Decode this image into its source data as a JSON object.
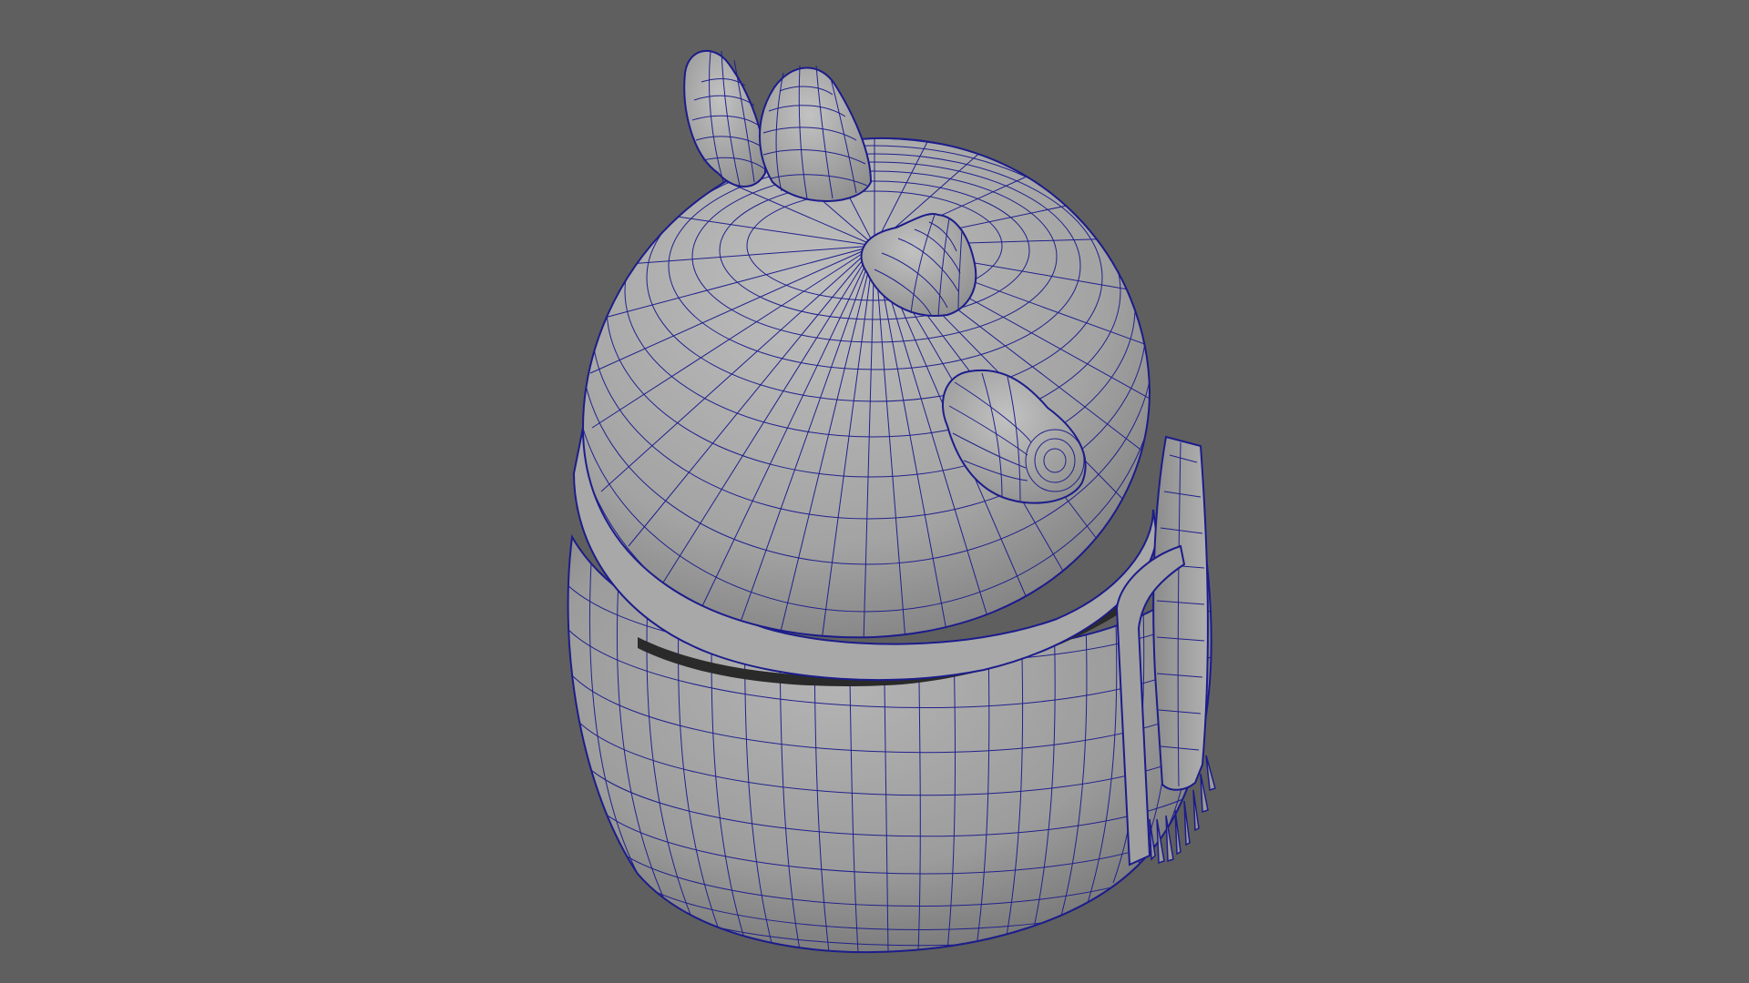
{
  "viewport": {
    "background_color": "#5f5f5f",
    "mesh_fill_color": "#9e9e9e",
    "wireframe_color": "#1c1c8c",
    "shading_mode": "wireframe-on-shaded",
    "object": "stylized-mug-character-with-horns-and-scarf"
  }
}
